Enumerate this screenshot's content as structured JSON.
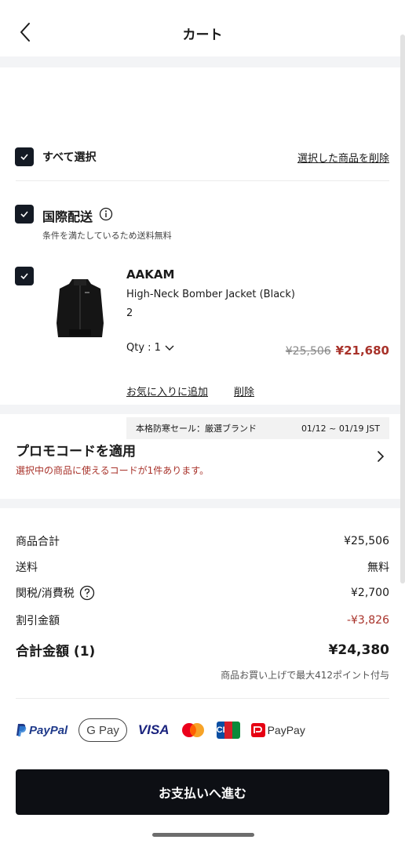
{
  "header": {
    "title": "カート"
  },
  "select_all": {
    "label": "すべて選択",
    "delete_selected": "選択した商品を削除"
  },
  "shipping": {
    "title": "国際配送",
    "note": "条件を満たしているため送料無料"
  },
  "item": {
    "brand": "AAKAM",
    "name": "High-Neck Bomber Jacket (Black)",
    "size": "2",
    "qty_label": "Qty : 1",
    "original_price": "¥25,506",
    "sale_price": "¥21,680",
    "add_favorite": "お気に入りに追加",
    "remove": "削除",
    "sale_name": "本格防寒セール：厳選ブランド",
    "sale_period": "01/12 ~ 01/19 JST"
  },
  "promo": {
    "title": "プロモコードを適用",
    "note": "選択中の商品に使えるコードが1件あります。"
  },
  "summary": {
    "subtotal_label": "商品合計",
    "subtotal_value": "¥25,506",
    "shipping_label": "送料",
    "shipping_value": "無料",
    "tax_label": "関税/消費税",
    "tax_value": "¥2,700",
    "discount_label": "割引金額",
    "discount_value": "-¥3,826",
    "total_label": "合計金額 (1)",
    "total_value": "¥24,380",
    "points_note": "商品お買い上げで最大412ポイント付与"
  },
  "payment_methods": {
    "paypal": "PayPal",
    "gpay": "G Pay",
    "visa": "VISA",
    "jcb": "JCB",
    "paypay": "PayPay"
  },
  "checkout": {
    "label": "お支払いへ進む"
  },
  "colors": {
    "accent_red": "#a8322a",
    "dark": "#141a24"
  }
}
